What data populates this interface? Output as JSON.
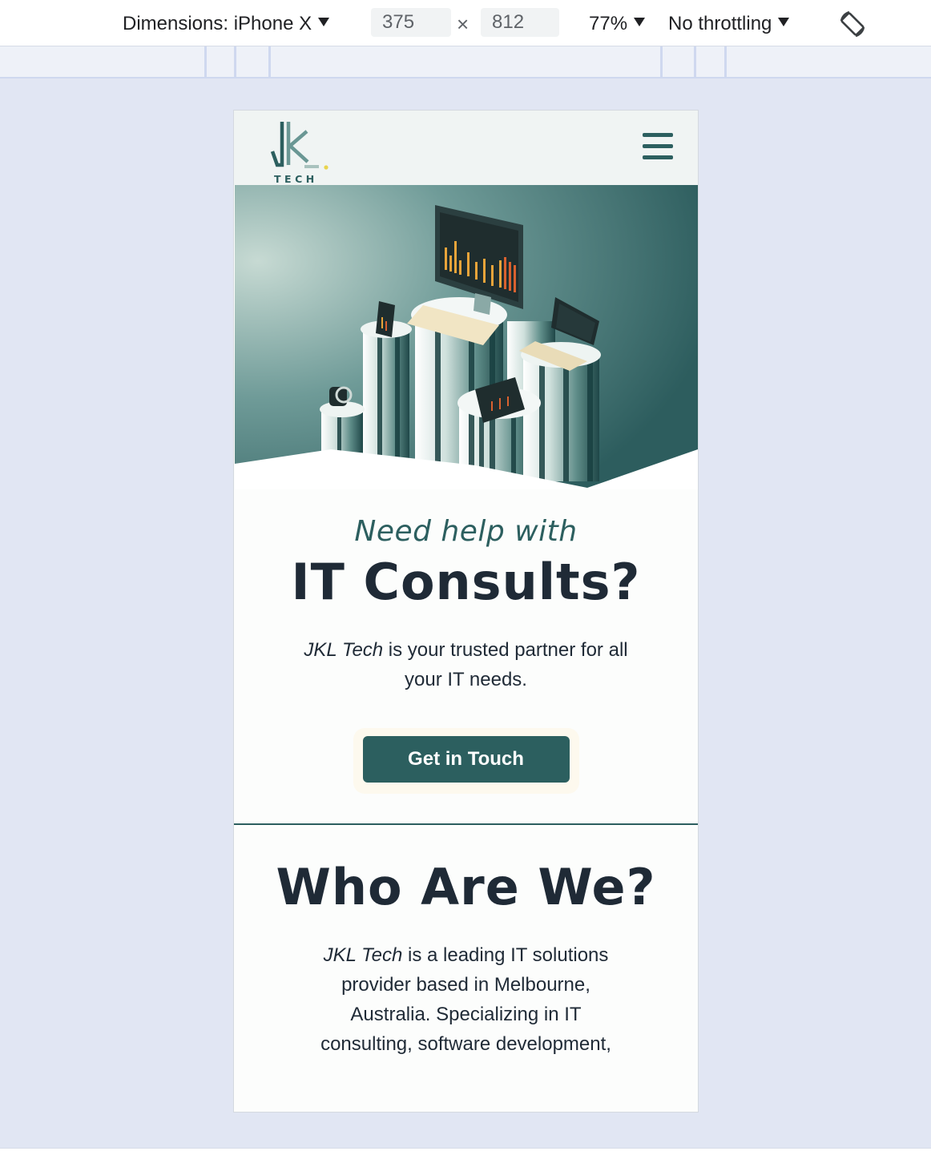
{
  "devtools": {
    "dimensions_label": "Dimensions: iPhone X",
    "width_value": "375",
    "times": "×",
    "height_value": "812",
    "zoom": "77%",
    "throttling": "No throttling"
  },
  "site": {
    "logo_letters": "JK",
    "logo_sub": "TECH",
    "hero": {
      "kicker": "Need help with",
      "headline": "IT Consults?",
      "lead_brand": "JKL Tech",
      "lead_rest": " is your trusted partner for all your IT needs.",
      "cta_label": "Get in Touch"
    },
    "about": {
      "heading": "Who Are We?",
      "brand": "JKL Tech",
      "text": " is a leading IT solutions provider based in Melbourne, Australia. Specializing in IT consulting, software development,"
    }
  },
  "colors": {
    "brand_teal": "#2c5f5f",
    "text_dark": "#1f2a36",
    "accent_yellow": "#e8d44d",
    "page_bg": "#e1e6f3"
  }
}
